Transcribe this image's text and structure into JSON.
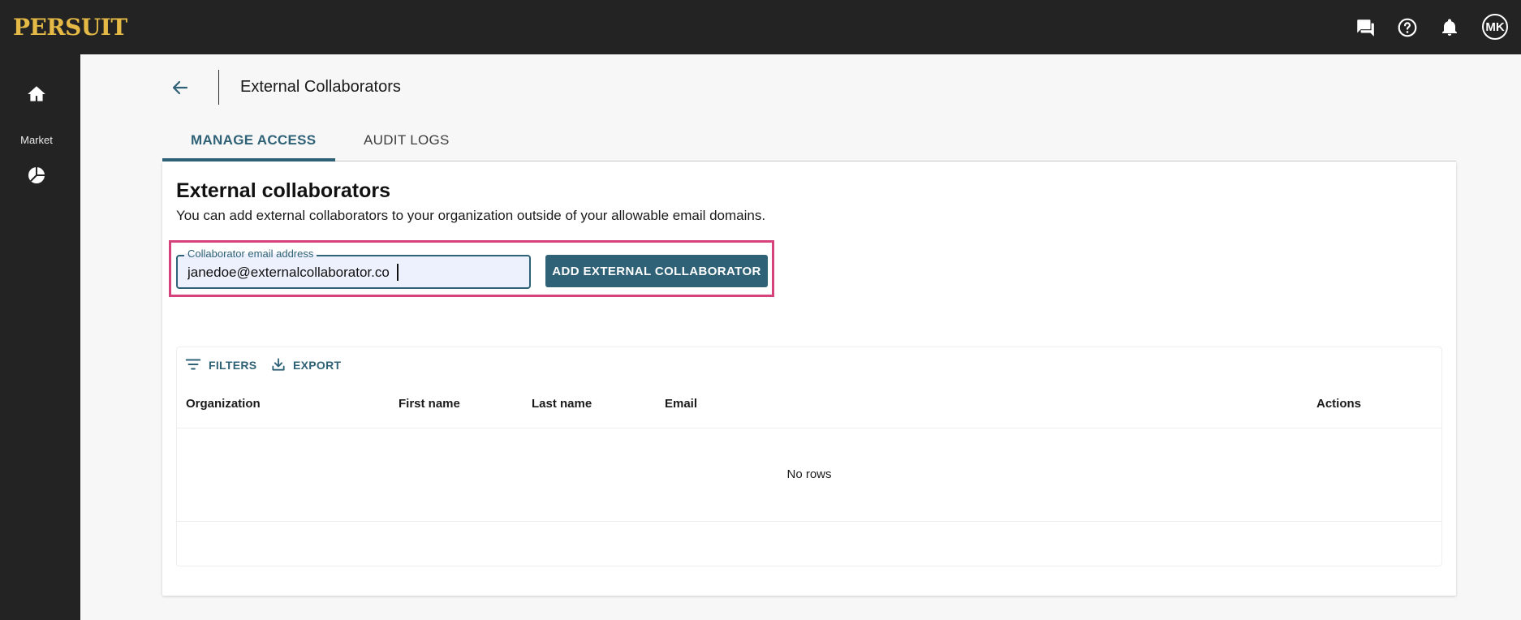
{
  "app": {
    "logo": "PERSUIT",
    "user_initials": "MK"
  },
  "topbar": {
    "icons": [
      "chat-icon",
      "help-icon",
      "notifications-icon"
    ]
  },
  "sidebar": {
    "items": [
      {
        "icon": "home-icon",
        "label": ""
      },
      {
        "icon": "market-icon",
        "label": "Market"
      }
    ]
  },
  "header": {
    "title": "External Collaborators"
  },
  "tabs": [
    {
      "label": "MANAGE ACCESS",
      "active": true
    },
    {
      "label": "AUDIT LOGS",
      "active": false
    }
  ],
  "section": {
    "title": "External collaborators",
    "description": "You can add external collaborators to your organization outside of your allowable email domains."
  },
  "form": {
    "label": "Collaborator email address",
    "value": "janedoe@externalcollaborator.co",
    "button": "ADD EXTERNAL COLLABORATOR"
  },
  "table": {
    "toolbar": {
      "filters": "FILTERS",
      "export": "EXPORT"
    },
    "columns": [
      "Organization",
      "First name",
      "Last name",
      "Email",
      "Actions"
    ],
    "empty": "No rows"
  },
  "colors": {
    "accent": "#2f6277",
    "highlight": "#d6427c",
    "logo": "#e4b946",
    "nav": "#232323"
  }
}
